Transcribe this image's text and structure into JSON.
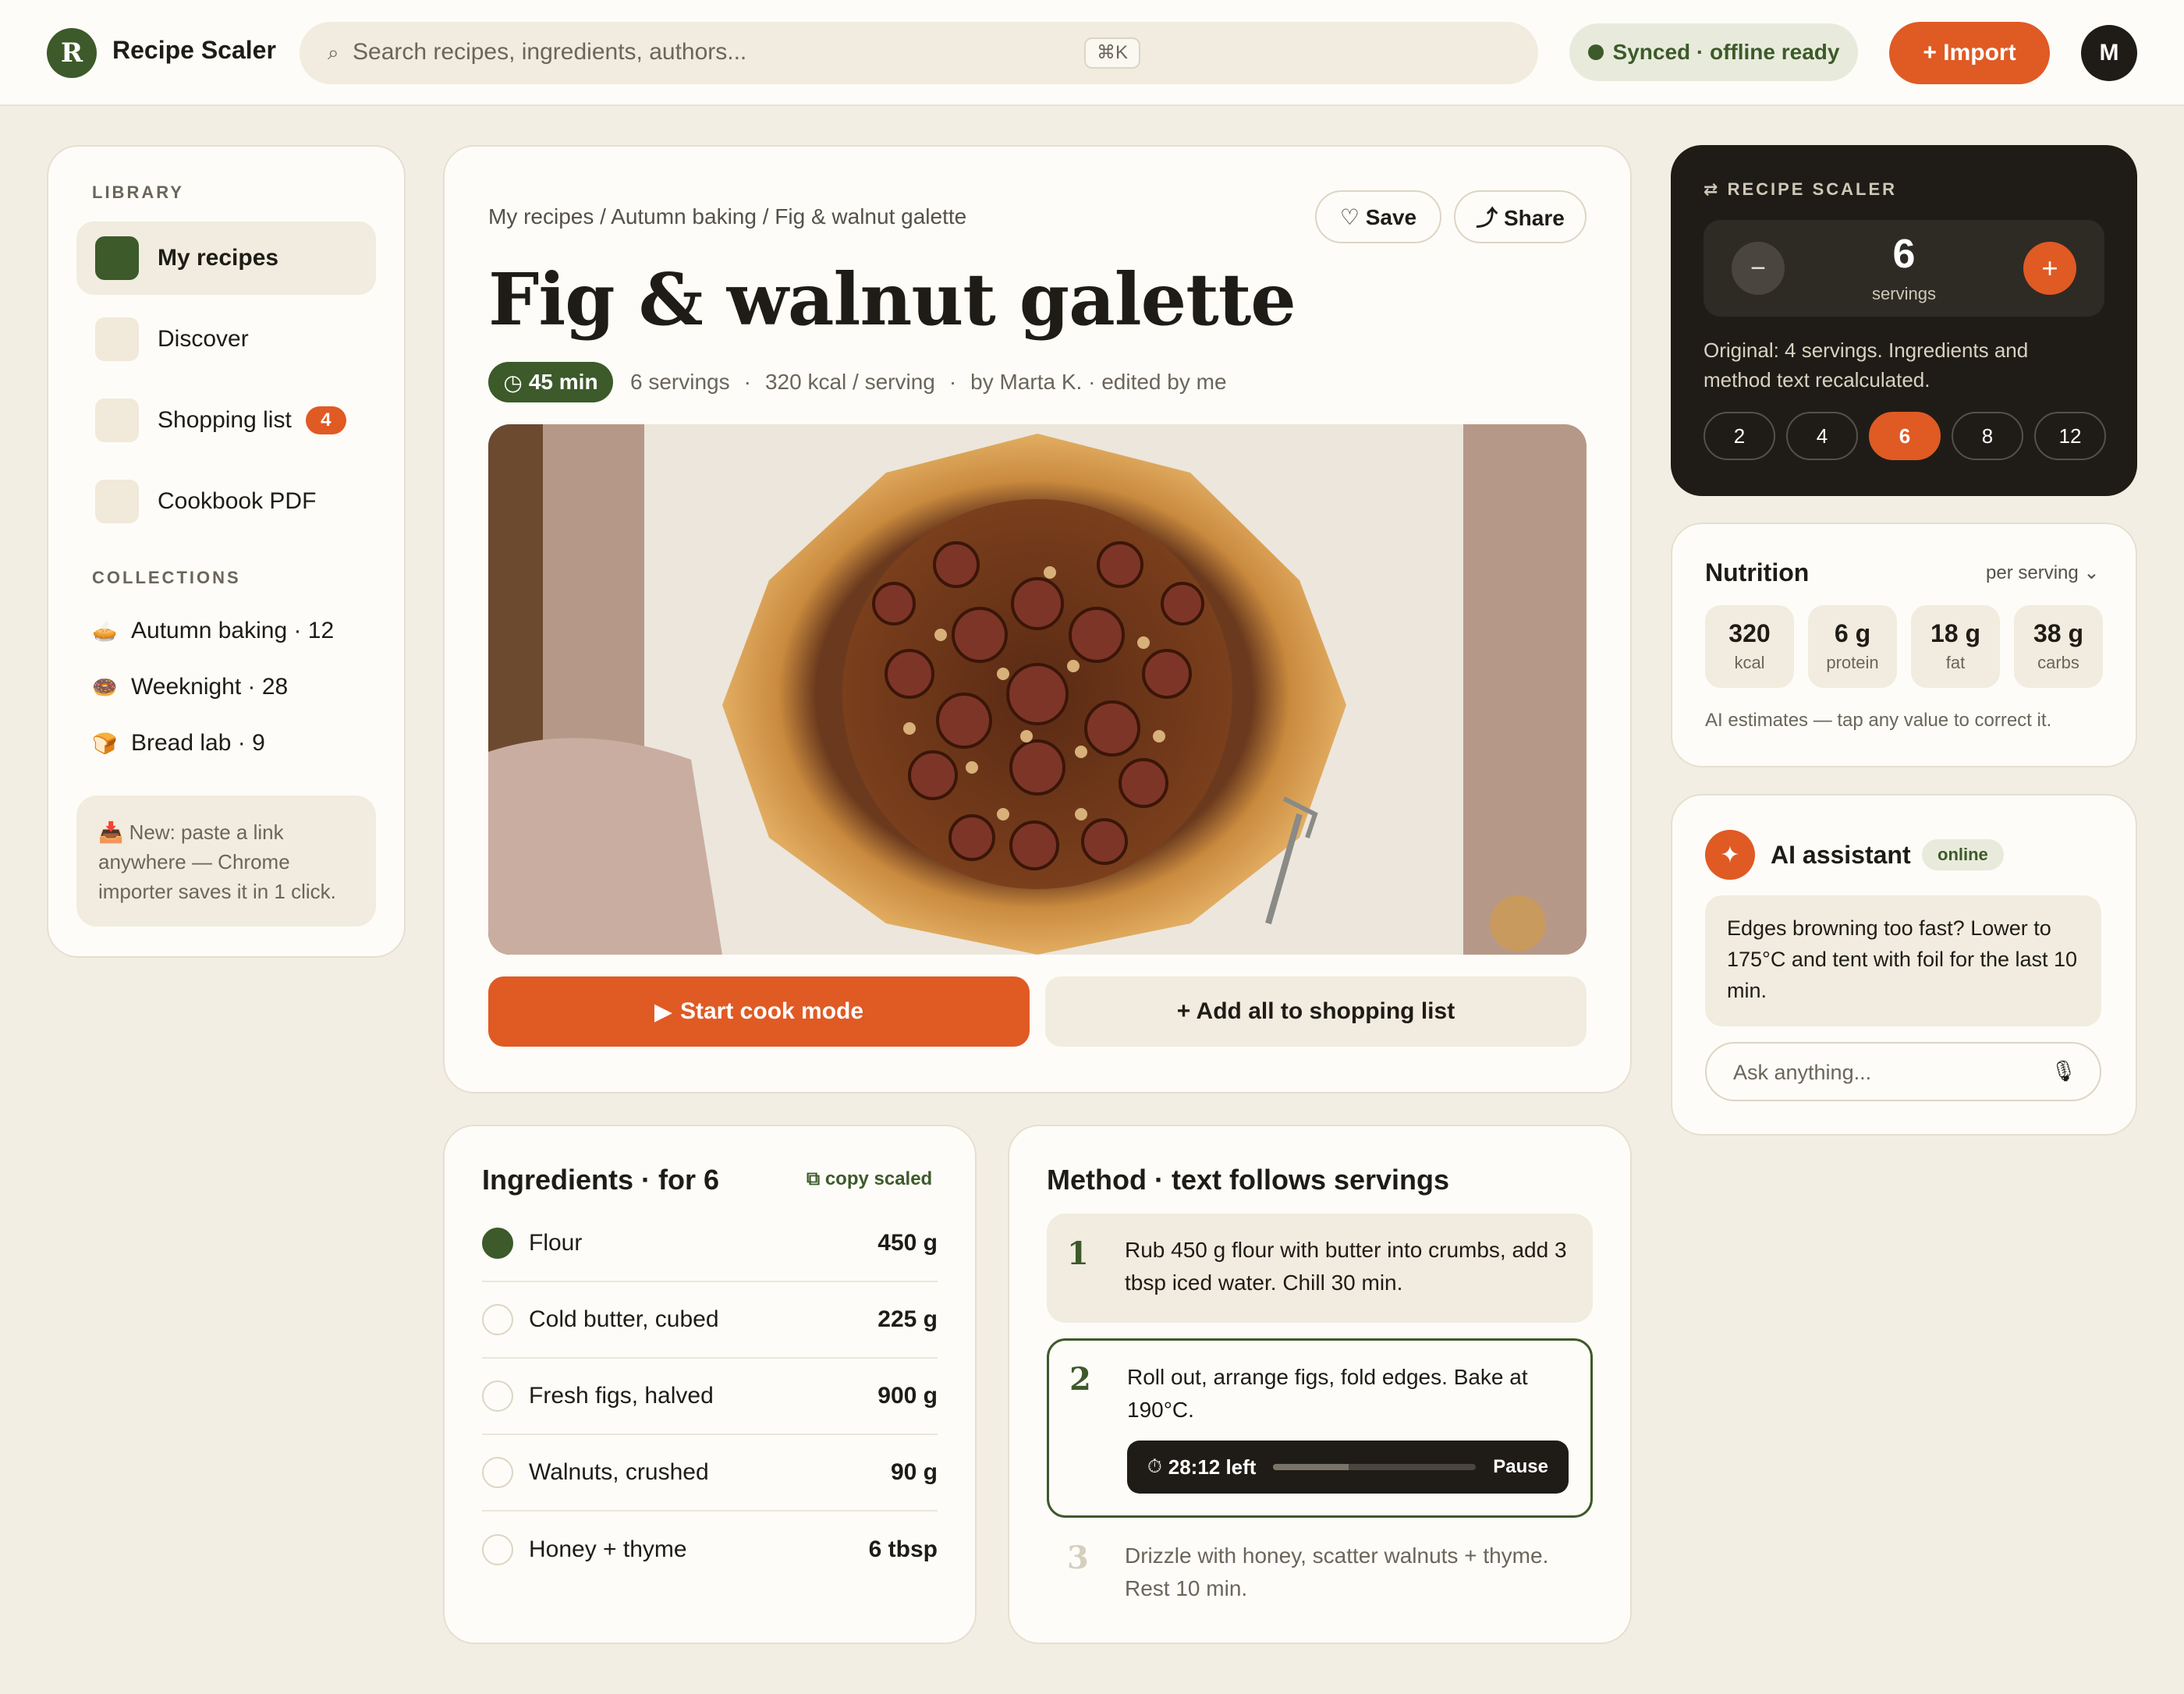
{
  "app": {
    "name": "Recipe Scaler",
    "logo_letter": "R",
    "avatar_letter": "M"
  },
  "search": {
    "placeholder": "Search recipes, ingredients, authors...",
    "shortcut": "⌘K"
  },
  "status": {
    "synced": "Synced · offline ready"
  },
  "import_label": "+ Import",
  "sidebar": {
    "library_title": "LIBRARY",
    "items": [
      {
        "label": "My recipes",
        "active": true
      },
      {
        "label": "Discover"
      },
      {
        "label": "Shopping list",
        "badge": "4"
      },
      {
        "label": "Cookbook PDF"
      }
    ],
    "collections_title": "COLLECTIONS",
    "collections": [
      {
        "emoji": "🥧",
        "label": "Autumn baking · 12"
      },
      {
        "emoji": "🍩",
        "label": "Weeknight · 28"
      },
      {
        "emoji": "🍞",
        "label": "Bread lab · 9"
      }
    ],
    "tip": "📥 New: paste a link anywhere — Chrome importer saves it in 1 click."
  },
  "recipe": {
    "breadcrumb": "My recipes / Autumn baking / Fig & walnut galette",
    "save_label": "♡ Save",
    "share_label": "⤴ Share",
    "title": "Fig & walnut galette",
    "time": "45 min",
    "servings": "6 servings",
    "kcal": "320 kcal / serving",
    "author": "by Marta K. · edited by me",
    "cook_label": "Start cook mode",
    "shop_label": "+ Add all to shopping list"
  },
  "ingredients": {
    "title": "Ingredients · for 6",
    "copy_label": "copy scaled",
    "items": [
      {
        "name": "Flour",
        "qty": "450 g",
        "checked": true
      },
      {
        "name": "Cold butter, cubed",
        "qty": "225 g",
        "checked": false
      },
      {
        "name": "Fresh figs, halved",
        "qty": "900 g",
        "checked": false
      },
      {
        "name": "Walnuts, crushed",
        "qty": "90 g",
        "checked": false
      },
      {
        "name": "Honey + thyme",
        "qty": "6 tbsp",
        "checked": false
      }
    ]
  },
  "method": {
    "title": "Method · text follows servings",
    "steps": [
      {
        "num": "1",
        "text": "Rub 450 g flour with butter into crumbs, add 3 tbsp iced water. Chill 30 min."
      },
      {
        "num": "2",
        "text": "Roll out, arrange figs, fold edges. Bake at 190°C."
      },
      {
        "num": "3",
        "text": "Drizzle with honey, scatter walnuts + thyme. Rest 10 min."
      }
    ],
    "timer": {
      "left": "28:12 left",
      "pause": "Pause",
      "progress": 0.37
    }
  },
  "scaler": {
    "title": "RECIPE SCALER",
    "servings": "6",
    "servings_label": "servings",
    "note": "Original: 4 servings. Ingredients and method text recalculated.",
    "presets": [
      "2",
      "4",
      "6",
      "8",
      "12"
    ],
    "selected": "6"
  },
  "nutrition": {
    "title": "Nutrition",
    "per": "per serving ⌄",
    "tiles": [
      {
        "value": "320",
        "unit": "kcal"
      },
      {
        "value": "6 g",
        "unit": "protein"
      },
      {
        "value": "18 g",
        "unit": "fat"
      },
      {
        "value": "38 g",
        "unit": "carbs"
      }
    ],
    "note": "AI estimates — tap any value to correct it."
  },
  "assistant": {
    "title": "AI assistant",
    "status": "online",
    "message": "Edges browning too fast? Lower to 175°C and tent with foil for the last 10 min.",
    "placeholder": "Ask anything..."
  },
  "colors": {
    "accent": "#e05a24",
    "brand": "#3d5a2a",
    "dark": "#1f1c17",
    "background": "#f3eee4"
  }
}
